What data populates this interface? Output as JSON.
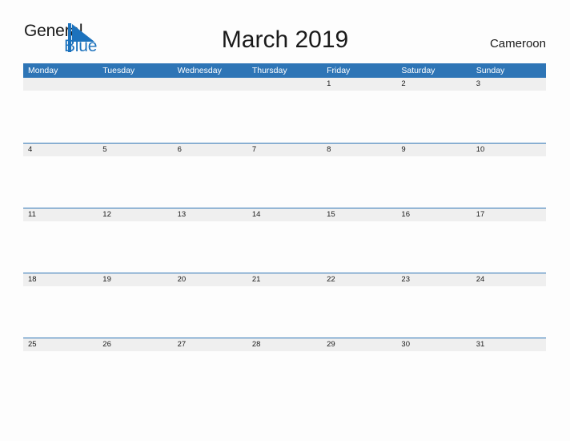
{
  "brand": {
    "name_part1": "General",
    "name_part2": "Blue",
    "flag_color": "#1c72bd"
  },
  "header": {
    "title": "March 2019",
    "country": "Cameroon"
  },
  "theme": {
    "header_blue": "#2e75b6",
    "date_band_gray": "#efefef",
    "page_background": "#fdfdfd",
    "text_color": "#1a1a1a",
    "header_text_color": "#ffffff"
  },
  "calendar": {
    "month": "March",
    "year": "2019",
    "weekday_headers": [
      "Monday",
      "Tuesday",
      "Wednesday",
      "Thursday",
      "Friday",
      "Saturday",
      "Sunday"
    ],
    "weeks": [
      [
        "",
        "",
        "",
        "",
        "1",
        "2",
        "3"
      ],
      [
        "4",
        "5",
        "6",
        "7",
        "8",
        "9",
        "10"
      ],
      [
        "11",
        "12",
        "13",
        "14",
        "15",
        "16",
        "17"
      ],
      [
        "18",
        "19",
        "20",
        "21",
        "22",
        "23",
        "24"
      ],
      [
        "25",
        "26",
        "27",
        "28",
        "29",
        "30",
        "31"
      ]
    ]
  }
}
